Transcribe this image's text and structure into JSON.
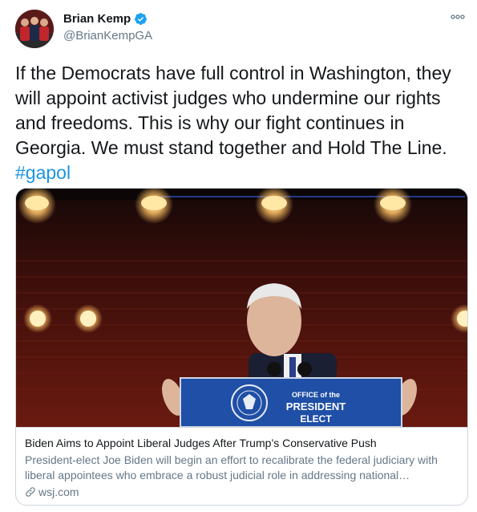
{
  "author": {
    "name": "Brian Kemp",
    "handle": "@BrianKempGA",
    "verified_color": "#1da1f2"
  },
  "tweet": {
    "text": "If the Democrats have full control in Washington, they will appoint activist judges who undermine our rights and freedoms. This is why our fight continues in Georgia. We must stand together and Hold The Line.",
    "hashtag": "#gapol"
  },
  "card": {
    "title": "Biden Aims to Appoint Liberal Judges After Trump’s Conservative Push",
    "description": "President-elect Joe Biden will begin an effort to recalibrate the federal judiciary with liberal appointees who embrace a robust judicial role in addressing national…",
    "domain": "wsj.com",
    "image": {
      "podium_line1": "OFFICE of the",
      "podium_line2": "PRESIDENT",
      "podium_line3": "ELECT"
    }
  },
  "icons": {
    "more": "more-dots-icon",
    "verified": "verified-badge-icon",
    "link": "link-icon"
  },
  "colors": {
    "link": "#1b95e0",
    "secondary_text": "#657786",
    "border": "#ccd6dd"
  }
}
